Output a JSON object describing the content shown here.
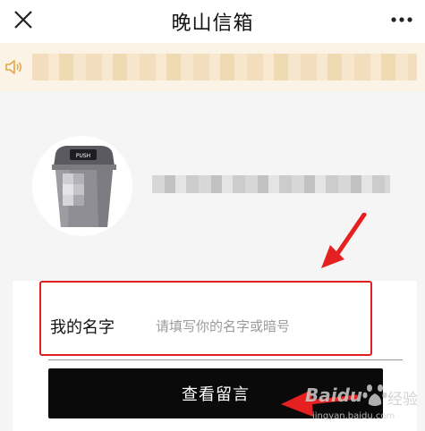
{
  "header": {
    "title": "晚山信箱",
    "close_icon": "close-icon",
    "more_icon": "more-dots-icon"
  },
  "notice": {
    "icon": "speaker-icon",
    "bg_color": "#fbf3e6"
  },
  "profile": {
    "avatar_icon": "trash-bin-icon",
    "bin_label": "PUSH"
  },
  "form": {
    "name_label": "我的名字",
    "name_placeholder": "请填写你的名字或暗号",
    "name_value": "",
    "view_button_label": "查看留言",
    "button_color": "#0a0a0a",
    "highlight_color": "#e02020"
  },
  "watermark": {
    "brand": "Baidu",
    "brand_cn": "经验",
    "url": "jingyan.baidu.com"
  }
}
